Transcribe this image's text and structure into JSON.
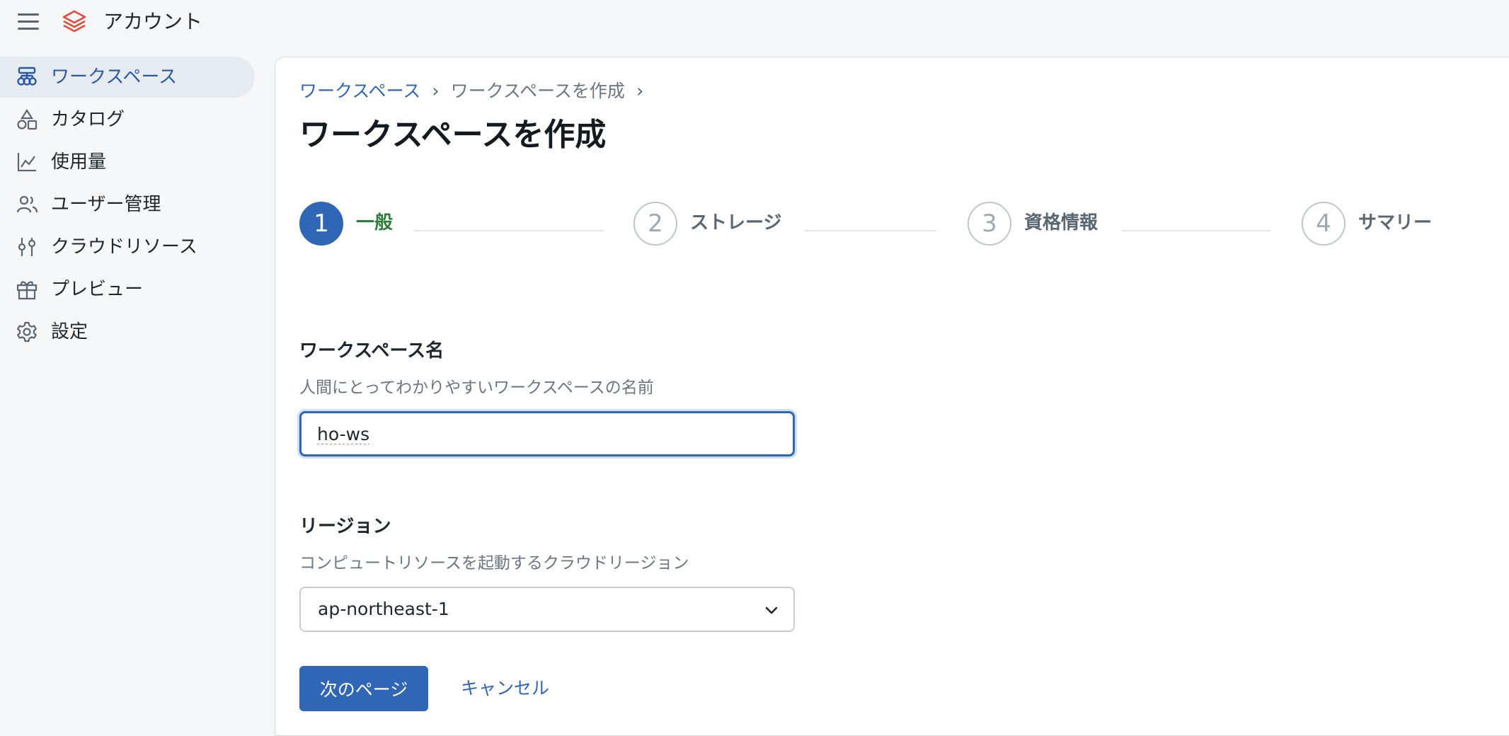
{
  "app": {
    "title": "アカウント"
  },
  "sidebar": {
    "items": [
      {
        "label": "ワークスペース",
        "icon": "workspace-icon",
        "active": true
      },
      {
        "label": "カタログ",
        "icon": "catalog-shapes-icon"
      },
      {
        "label": "使用量",
        "icon": "line-chart-icon"
      },
      {
        "label": "ユーザー管理",
        "icon": "users-icon"
      },
      {
        "label": "クラウドリソース",
        "icon": "sliders-icon"
      },
      {
        "label": "プレビュー",
        "icon": "gift-icon"
      },
      {
        "label": "設定",
        "icon": "gear-icon"
      }
    ]
  },
  "breadcrumb": {
    "items": [
      "ワークスペース",
      "ワークスペースを作成"
    ],
    "separator": "›"
  },
  "page": {
    "title": "ワークスペースを作成"
  },
  "stepper": {
    "steps": [
      {
        "number": "1",
        "label": "一般",
        "state": "active"
      },
      {
        "number": "2",
        "label": "ストレージ",
        "state": "inactive"
      },
      {
        "number": "3",
        "label": "資格情報",
        "state": "inactive"
      },
      {
        "number": "4",
        "label": "サマリー",
        "state": "inactive"
      }
    ]
  },
  "form": {
    "workspace_name": {
      "label": "ワークスペース名",
      "help": "人間にとってわかりやすいワークスペースの名前",
      "value": "ho-ws"
    },
    "region": {
      "label": "リージョン",
      "help": "コンピュートリソースを起動するクラウドリージョン",
      "value": "ap-northeast-1"
    }
  },
  "actions": {
    "next_label": "次のページ",
    "cancel_label": "キャンセル"
  },
  "colors": {
    "accent": "#2f67b6",
    "active_step_label": "#2e7d3a",
    "background": "#f6f7f9"
  }
}
